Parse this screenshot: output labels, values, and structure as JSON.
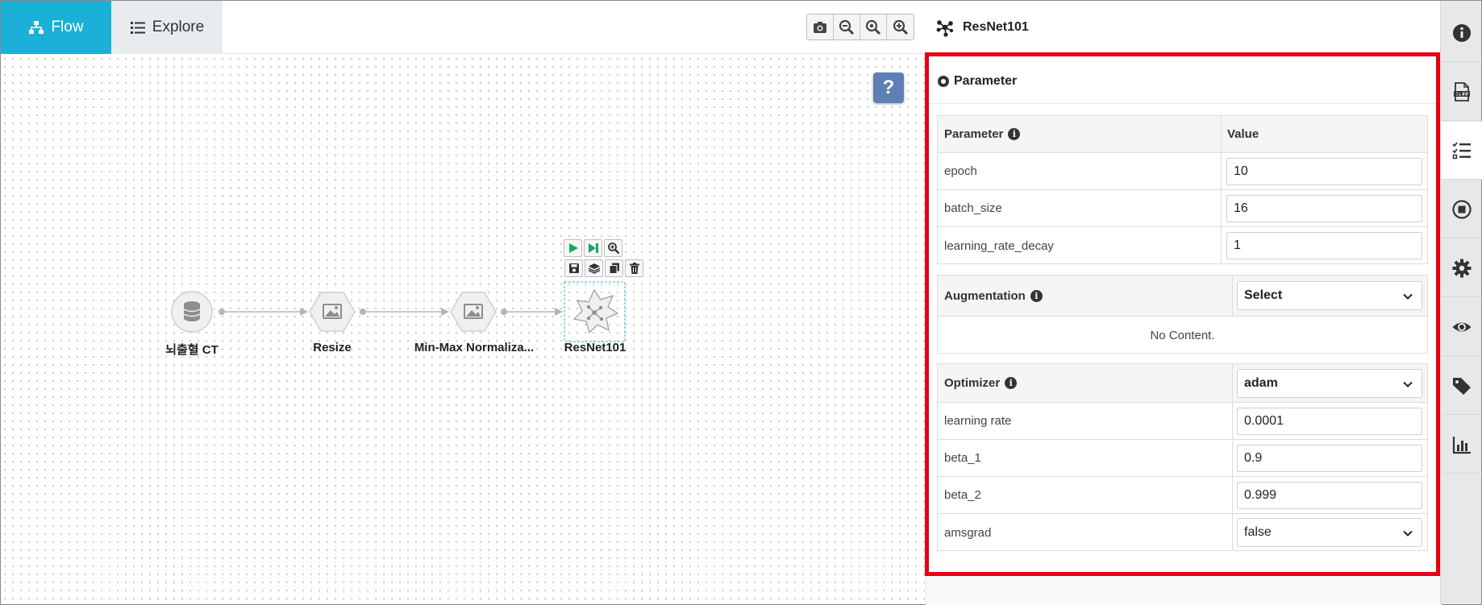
{
  "tabs": [
    {
      "label": "Flow",
      "icon": "sitemap-icon",
      "active": true
    },
    {
      "label": "Explore",
      "icon": "list-icon",
      "active": false
    }
  ],
  "canvas_toolbar": {
    "icons": [
      "camera-icon",
      "zoom-out-icon",
      "zoom-reset-icon",
      "zoom-in-icon"
    ]
  },
  "help": {
    "label": "?"
  },
  "nodes": [
    {
      "label": "뇌출혈 CT",
      "icon": "database-icon"
    },
    {
      "label": "Resize",
      "icon": "image-icon"
    },
    {
      "label": "Min-Max Normaliza...",
      "icon": "image-icon"
    },
    {
      "label": "ResNet101",
      "icon": "network-icon",
      "selected": true
    }
  ],
  "node_tools": [
    "play-icon",
    "step-forward-icon",
    "zoom-icon",
    "save-icon",
    "layers-icon",
    "copy-icon",
    "trash-icon"
  ],
  "panel": {
    "title": "ResNet101",
    "section_title": "Parameter",
    "params_table": {
      "header": {
        "name": "Parameter",
        "value": "Value"
      },
      "rows": [
        {
          "name": "epoch",
          "value": "10"
        },
        {
          "name": "batch_size",
          "value": "16"
        },
        {
          "name": "learning_rate_decay",
          "value": "1"
        }
      ]
    },
    "augmentation": {
      "label": "Augmentation",
      "selected": "Select",
      "empty_text": "No Content."
    },
    "optimizer": {
      "label": "Optimizer",
      "selected": "adam",
      "rows": [
        {
          "name": "learning rate",
          "value": "0.0001"
        },
        {
          "name": "beta_1",
          "value": "0.9"
        },
        {
          "name": "beta_2",
          "value": "0.999"
        }
      ],
      "amsgrad": {
        "name": "amsgrad",
        "value": "false"
      }
    }
  },
  "sidebar": {
    "icons": [
      "info-icon",
      "class-icon",
      "checklist-icon",
      "stop-icon",
      "gear-icon",
      "eye-icon",
      "tag-icon",
      "bar-chart-icon"
    ],
    "active_index": 2
  },
  "colors": {
    "accent": "#1ab0d8",
    "highlight": "#e60012",
    "help": "#5e7fb6"
  }
}
